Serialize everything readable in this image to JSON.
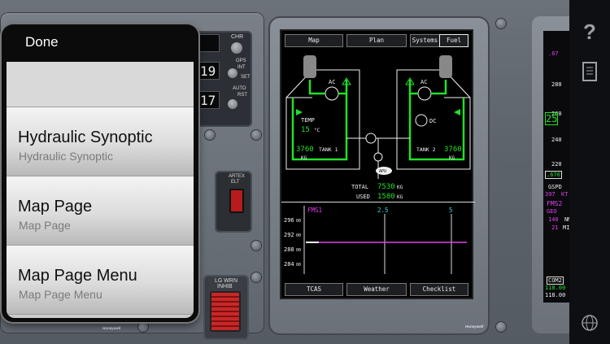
{
  "menu": {
    "done_label": "Done",
    "items": [
      {
        "title": "Hydraulic Synoptic",
        "subtitle": "Hydraulic Synoptic"
      },
      {
        "title": "Map Page",
        "subtitle": "Map Page"
      },
      {
        "title": "Map Page Menu",
        "subtitle": "Map Page Menu"
      }
    ]
  },
  "left_panel": {
    "chr_label": "CHR",
    "display_top": "19",
    "display_bottom": "17",
    "gps_label": "GPS",
    "int_label": "INT",
    "set_label": "SET",
    "auto_label": "AUTO",
    "rst_label": "RST",
    "artex_label": "ARTEX",
    "elt_label": "ELT",
    "lg_wrn_label": "LG WRN",
    "inhib_label": "INHIB",
    "brand": "Honeywell"
  },
  "mfd": {
    "top_buttons": [
      "Map",
      "Plan",
      "Systems",
      "Fuel"
    ],
    "bottom_buttons": [
      "TCAS",
      "Weather",
      "Checklist"
    ],
    "fuel": {
      "ac_left": "AC",
      "ac_right": "AC",
      "dc": "DC",
      "temp_label": "TEMP",
      "temp_value": "15",
      "temp_unit": "°C",
      "tank1_value": "3760",
      "tank1_label": "TANK 1",
      "tank1_unit": "KG",
      "tank2_value": "3760",
      "tank2_label": "TANK 2",
      "tank2_unit": "KG",
      "apu_label": "APU",
      "total_label": "TOTAL",
      "total_value": "7530",
      "total_unit": "KG",
      "used_label": "USED",
      "used_value": "1580",
      "used_unit": "KG"
    },
    "vsd": {
      "source": "FMS1",
      "range_mid": "2.5",
      "range_end": "5",
      "altitudes": [
        "296",
        "292",
        "288",
        "284"
      ],
      "alt_suffix": "00"
    },
    "brand": "Honeywell",
    "colors": {
      "green": "#22e028",
      "cyan": "#32d6e6",
      "magenta": "#e040ec",
      "white": "#f2f2f2"
    }
  },
  "pfd": {
    "speed_sel": ".67",
    "tape": [
      "280",
      "260",
      "240",
      "220"
    ],
    "pointer_value": "25",
    "mach": ".670",
    "gspd_label": "GSPD",
    "gspd_value": "397",
    "gspd_unit": "KT",
    "fms_label": "FMS2",
    "geo_label": "GEO",
    "nm1_value": "140",
    "nm2_value": "21",
    "nm_unit": "NM",
    "min_unit": "MIN",
    "com_label": "COM2",
    "com_active": "118.00",
    "com_standby": "118.00"
  },
  "appbar": {
    "icons": [
      "help-icon",
      "notes-icon",
      "globe-icon"
    ]
  }
}
